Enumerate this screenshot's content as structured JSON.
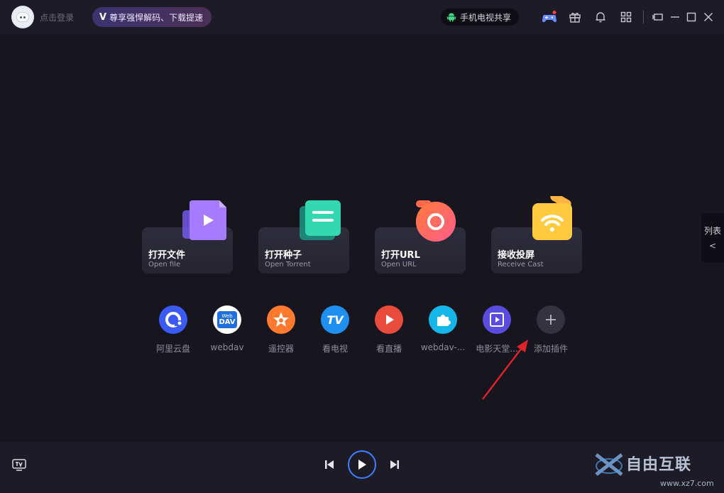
{
  "header": {
    "login_text": "点击登录",
    "vip_logo": "V",
    "vip_text": "尊享强悍解码、下载提速",
    "share_text": "手机电视共享",
    "icons": [
      "game-icon",
      "gift-icon",
      "bell-icon",
      "apps-grid-icon",
      "mini-mode-icon",
      "minimize-icon",
      "maximize-icon",
      "close-icon"
    ]
  },
  "cards": [
    {
      "title": "打开文件",
      "subtitle": "Open file"
    },
    {
      "title": "打开种子",
      "subtitle": "Open Torrent"
    },
    {
      "title": "打开URL",
      "subtitle": "Open URL"
    },
    {
      "title": "接收投屏",
      "subtitle": "Receive Cast"
    }
  ],
  "plugins": [
    {
      "label": "阿里云盘",
      "color": "#3b5bf5"
    },
    {
      "label": "webdav",
      "color": "#ffffff"
    },
    {
      "label": "遥控器",
      "color": "#ff7a2e"
    },
    {
      "label": "看电视",
      "color": "#1f8ff0"
    },
    {
      "label": "看直播",
      "color": "#e94b3c"
    },
    {
      "label": "webdav-...",
      "color": "#15b7e8"
    },
    {
      "label": "电影天堂...",
      "color": "#5b4ce0"
    },
    {
      "label": "添加插件",
      "color": "#33323e"
    }
  ],
  "webdav_badge": {
    "top": "Web",
    "bottom": "DAV"
  },
  "tv_badge": "TV",
  "sidebar": {
    "label": "列表",
    "chevron": "<"
  },
  "footer": {
    "watermark": "自由互联",
    "watermark_url": "www.xz7.com"
  },
  "colors": {
    "accent": "#3d7fff",
    "background": "#17161f",
    "bar": "#1d1c26",
    "arrow": "#e0232b"
  }
}
